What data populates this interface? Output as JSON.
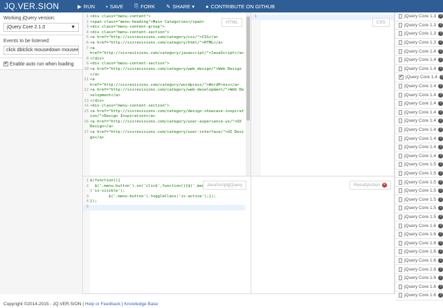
{
  "header": {
    "logo": "JQ.VER.SION",
    "nav": [
      {
        "icon": "play-icon",
        "glyph": "▶",
        "label": "RUN"
      },
      {
        "icon": "save-icon",
        "glyph": "▪",
        "label": "SAVE"
      },
      {
        "icon": "fork-icon",
        "glyph": "⎘",
        "label": "FORK"
      },
      {
        "icon": "share-icon",
        "glyph": "✎",
        "label": "SHARE ▾"
      },
      {
        "icon": "github-icon",
        "glyph": "●",
        "label": "CONTRIBUTE ON GITHUB"
      }
    ]
  },
  "sidebar": {
    "version_label": "Working jQuery version:",
    "version_value": "jQuery Core 2.1.0",
    "events_label": "Events to be listened:",
    "events_value": "click dblclick mousedown mouseenter",
    "autorun_label": "Enable auto run when loading",
    "autorun_checked": true
  },
  "html_editor": {
    "tag": "HTML",
    "lines": [
      {
        "n": "1",
        "t": "<div class=\"menu-content\">"
      },
      {
        "n": "2",
        "t": "<span class=\"menu-heading\">Main Categories</span>"
      },
      {
        "n": "3",
        "t": "<div class=\"menu-content-group\">"
      },
      {
        "n": "4",
        "t": "<div class=\"menu-content-section\">"
      },
      {
        "n": "5",
        "t": "<a href=\"http://sixrevisions.com/category/css/\">CSS</a>"
      },
      {
        "n": "6",
        "t": "<a href=\"http://sixrevisions.com/category/html/\">HTML</a>"
      },
      {
        "n": "7",
        "t": "<a\nhref=\"http://sixrevisions.com/category/javascript/\">JavaScript</a>"
      },
      {
        "n": "8",
        "t": "</div>"
      },
      {
        "n": "9",
        "t": "<div class=\"menu-content-section\">"
      },
      {
        "n": "10",
        "t": "<a href=\"http://sixrevisions.com/category/web_design/\">Web Design</a>"
      },
      {
        "n": "11",
        "t": "<a\nhref=\"http://sixrevisions.com/category/wordpress/\">WordPress</a>"
      },
      {
        "n": "12",
        "t": "<a href=\"http://sixrevisions.com/category/web-development/\">Web Development</a>"
      },
      {
        "n": "13",
        "t": "</div>"
      },
      {
        "n": "14",
        "t": "<div class=\"menu-content-section\">"
      },
      {
        "n": "15",
        "t": "<a href=\"http://sixrevisions.com/category/design-showcase-inspiration/\">Design Inspiration</a>"
      },
      {
        "n": "16",
        "t": "<a href=\"http://sixrevisions.com/category/user-experience-ux/\">UX Design</a>"
      },
      {
        "n": "17",
        "t": "<a href=\"http://sixrevisions.com/category/user-interface/\">UI Design</a>"
      }
    ]
  },
  "css_editor": {
    "tag": "CSS",
    "lines": [
      {
        "n": "1",
        "t": ""
      }
    ]
  },
  "js_editor": {
    "tag": "JavaScript|jQuery",
    "lines": [
      {
        "n": "1",
        "t": "$(function(){"
      },
      {
        "n": "2",
        "t": "  $('.menu-button').on('click',function(){$('.menu').toggleClass('is-visible');"
      },
      {
        "n": "3",
        "t": "        $('.menu-button').toggleClass('is-active');});"
      },
      {
        "n": "4",
        "t": "});"
      },
      {
        "n": "5",
        "t": ""
      }
    ]
  },
  "result": {
    "tag": "Result|Action"
  },
  "versions": {
    "checked_index": 7,
    "items": [
      "jQuery Core 1.3",
      "jQuery Core 1.3",
      "jQuery Core 1.3",
      "jQuery Core 1.3",
      "jQuery Core 1.4",
      "jQuery Core 1.4",
      "jQuery Core 1.4",
      "jQuery Core 1.4",
      "jQuery Core 1.4",
      "jQuery Core 1.4",
      "jQuery Core 1.4",
      "jQuery Core 1.4",
      "jQuery Core 1.4",
      "jQuery Core 1.4",
      "jQuery Core 1.4",
      "jQuery Core 1.4",
      "jQuery Core 1.4",
      "jQuery Core 1.5",
      "jQuery Core 1.5",
      "jQuery Core 1.5",
      "jQuery Core 1.5",
      "jQuery Core 1.5",
      "jQuery Core 1.5",
      "jQuery Core 1.5",
      "jQuery Core 1.6",
      "jQuery Core 1.6",
      "jQuery Core 1.6",
      "jQuery Core 1.6",
      "jQuery Core 1.6",
      "jQuery Core 1.6",
      "jQuery Core 1.6",
      "jQuery Core 1.6",
      "jQuery Core 1.6"
    ]
  },
  "footer": {
    "copyright": "Copyright ©2014-2015 - JQ.VER.SION",
    "sep": " | ",
    "help": "Help or Feedback",
    "kb": "Knowledge Base"
  },
  "colors": {
    "header": "#2e5e95",
    "error": "#c0392b"
  }
}
